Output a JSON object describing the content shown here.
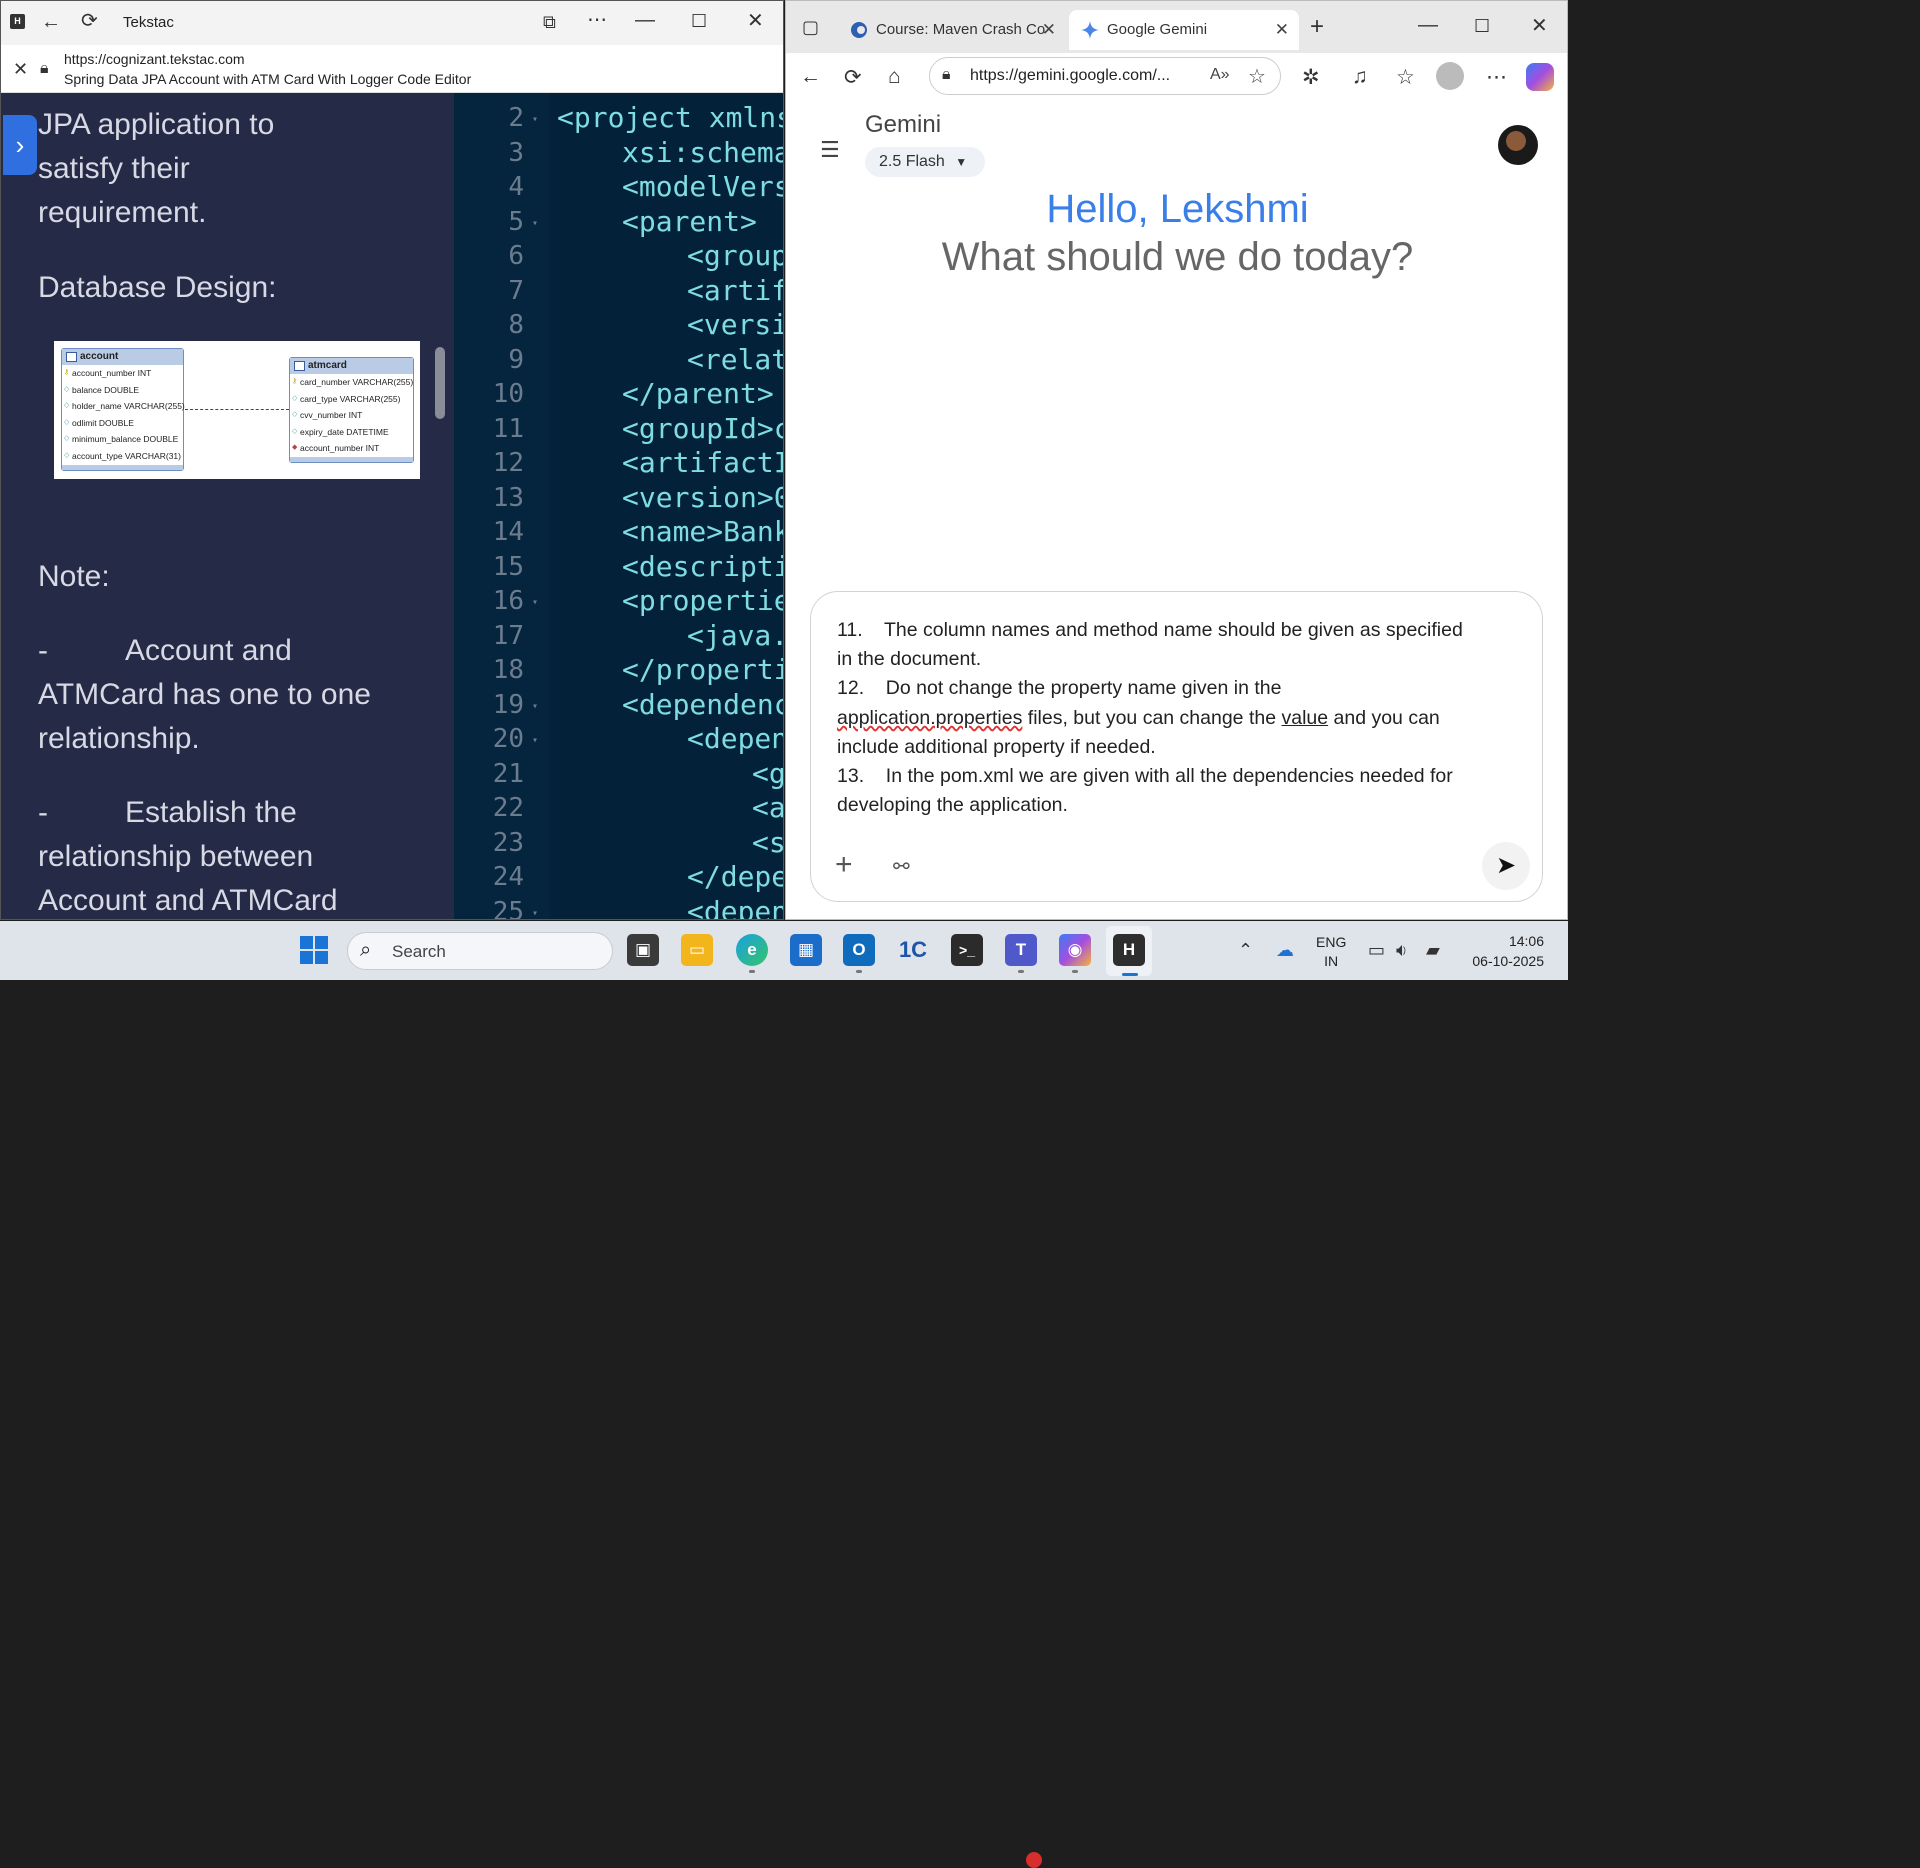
{
  "left_window": {
    "title": "Tekstac",
    "url": "https://cognizant.tekstac.com",
    "page_title": "Spring Data JPA Account with ATM Card With Logger Code Editor",
    "doc": {
      "lines": [
        "JPA application to",
        "satisfy their",
        "requirement."
      ],
      "db_heading": "Database Design:",
      "note_heading": "Note:",
      "note1_dash": "-",
      "note1": [
        "Account and",
        "ATMCard has one to one",
        "relationship."
      ],
      "note2_dash": "-",
      "note2": [
        "Establish the",
        "relationship between",
        "Account and ATMCard"
      ]
    },
    "erd": {
      "account": {
        "name": "account",
        "columns": [
          "account_number INT",
          "balance DOUBLE",
          "holder_name VARCHAR(255)",
          "odlimit DOUBLE",
          "minimum_balance DOUBLE",
          "account_type VARCHAR(31)"
        ]
      },
      "atmcard": {
        "name": "atmcard",
        "columns": [
          "card_number VARCHAR(255)",
          "card_type VARCHAR(255)",
          "cvv_number INT",
          "expiry_date DATETIME",
          "account_number INT"
        ]
      }
    },
    "code": {
      "line_numbers": [
        "2",
        "3",
        "4",
        "5",
        "6",
        "7",
        "8",
        "9",
        "10",
        "11",
        "12",
        "13",
        "14",
        "15",
        "16",
        "17",
        "18",
        "19",
        "20",
        "21",
        "22",
        "23",
        "24",
        "25"
      ],
      "lines": [
        "<project xmlns",
        "xsi:schema",
        "<modelVers",
        "<parent>",
        "<group",
        "<artif",
        "<versi",
        "<relat",
        "</parent>",
        "<groupId>c",
        "<artifactI",
        "<version>0",
        "<name>Bank",
        "<descripti",
        "<propertie",
        "<java.",
        "</properti",
        "<dependenc",
        "<depen",
        "<g",
        "<a",
        "<s",
        "</depe",
        "<depen"
      ]
    }
  },
  "right_window": {
    "tabs": [
      {
        "label": "Course: Maven Crash Co"
      },
      {
        "label": "Google Gemini"
      }
    ],
    "address": "https://gemini.google.com/...",
    "gemini": {
      "title": "Gemini",
      "model": "2.5 Flash",
      "hello": "Hello, Lekshmi",
      "subtitle": "What should we do today?",
      "input_lines": {
        "l1": "11.    The column names and method name should be given as specified",
        "l2": "in the document.",
        "l3": "12.    Do not change the property name given in the",
        "l4a": "application.properties",
        "l4b": " files, but you can change the ",
        "l4c": "value",
        "l4d": " and you can",
        "l5": "include additional property if needed.",
        "l6": "13.    In the pom.xml we are given with all the dependencies needed for",
        "l7": "developing the application."
      }
    }
  },
  "taskbar": {
    "search_placeholder": "Search",
    "lang_top": "ENG",
    "lang_bottom": "IN",
    "time": "14:06",
    "date": "06-10-2025"
  }
}
